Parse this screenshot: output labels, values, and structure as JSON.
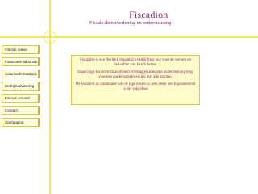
{
  "header": {
    "title": "Fiscadion",
    "subtitle": "Fiscale dienstverlening en ondersteuning"
  },
  "sidebar": {
    "items": [
      {
        "label": "Fiscale zaken"
      },
      {
        "label": "Financiële administratie"
      },
      {
        "label": "Salarisadministratie"
      },
      {
        "label": "Bedrijfsadvisering"
      },
      {
        "label": "Fiscaal actueel"
      },
      {
        "label": "Contact"
      },
      {
        "label": "Startpagina"
      }
    ]
  },
  "main": {
    "paragraphs": [
      "Fiscadion is een flexibel, dynamisch bedrijf met oog voor de wensen en behoeften van haar klanten.",
      "Naast hoge kwaliteit staan dienstverlening en adequate ondersteuning borg voor een goede samenwerking met alle klanten.",
      "De kwaliteit in combinatie met de lage kosten is zeer zeker een bijzonderheid in dat vakgebied"
    ]
  },
  "colors": {
    "accent_line": "#f2e75e",
    "text": "#8a2a6a",
    "content_bg": "#fffccc"
  }
}
